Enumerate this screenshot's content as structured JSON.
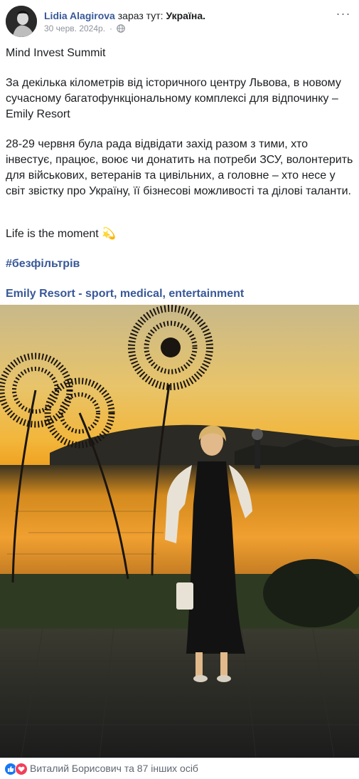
{
  "post": {
    "author": "Lidia Alagirova",
    "is_at": "зараз тут:",
    "location": "Україна.",
    "date": "30 черв. 2024р.",
    "separator": "·",
    "privacy_icon": "globe-icon",
    "more_icon": "more-options-icon",
    "more_glyph": "···"
  },
  "text": {
    "p1": "Mind Invest Summit",
    "p2": "За декілька кілометрів від історичного центру Львова, в новому сучасному багатофункціональному комплексі для відпочинку – Emily Resort",
    "p3": "28-29 червня була рада відвідати захід разом з тими, хто інвестує, працює, воює чи донатить на потреби ЗСУ, волонтерить для військових, ветеранів та цивільних, а головне – хто несе у світ звістку про Україну, її бізнесові можливості та ділові таланти.",
    "p4": "Life is the moment",
    "p4_emoji": "💫",
    "hashtag": "#безфільтрів",
    "page_link": "Emily Resort - sport, medical, entertainment"
  },
  "footer": {
    "reactions": [
      "like-icon",
      "love-icon"
    ],
    "reactors": "Виталий Борисович та 87 інших осіб"
  },
  "colors": {
    "link": "#385898",
    "like": "#1877f2",
    "love": "#f33e58",
    "sky_top": "#b8a97a",
    "sunset": "#f0a020"
  }
}
